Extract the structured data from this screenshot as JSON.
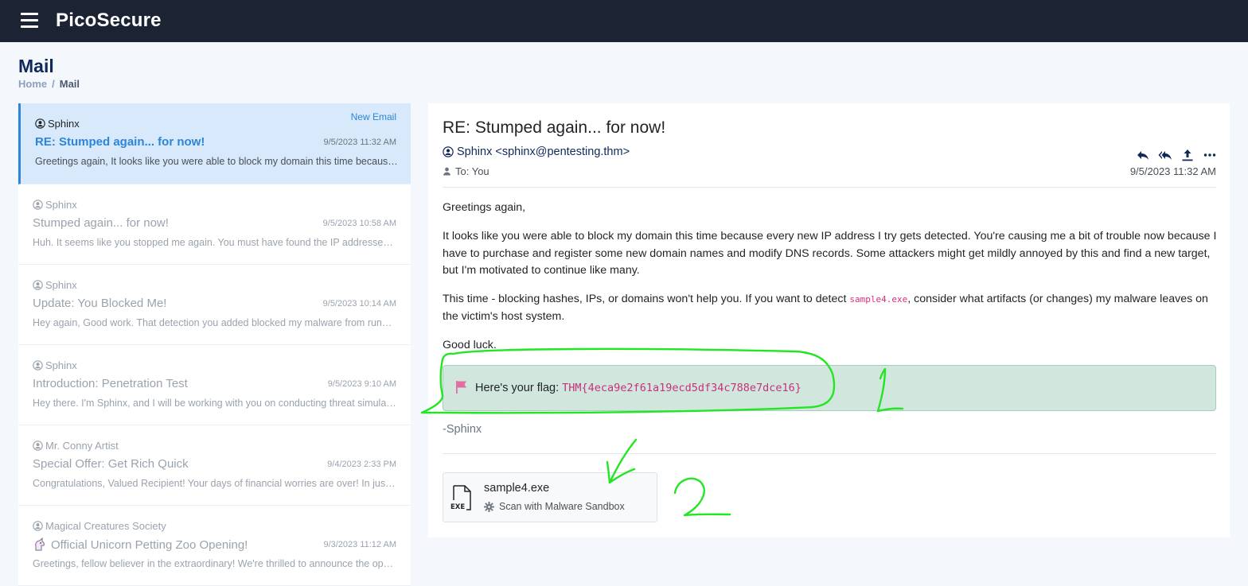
{
  "app": {
    "brand": "PicoSecure"
  },
  "page": {
    "title": "Mail",
    "breadcrumb": {
      "home": "Home",
      "separator": "/",
      "current": "Mail"
    }
  },
  "mail_list": [
    {
      "sender": "Sphinx",
      "subject": "RE: Stumped again... for now!",
      "date": "9/5/2023 11:32 AM",
      "badge": "New Email",
      "preview": "Greetings again, It looks like you were able to block my domain this time because every new IP address I try gets detected.",
      "active": true
    },
    {
      "sender": "Sphinx",
      "subject": "Stumped again... for now!",
      "date": "9/5/2023 10:58 AM",
      "preview": "Huh. It seems like you stopped me again. You must have found the IP addresses I was using."
    },
    {
      "sender": "Sphinx",
      "subject": "Update: You Blocked Me!",
      "date": "9/5/2023 10:14 AM",
      "preview": "Hey again, Good work. That detection you added blocked my malware from running."
    },
    {
      "sender": "Sphinx",
      "subject": "Introduction: Penetration Test",
      "date": "9/5/2023 9:10 AM",
      "preview": "Hey there. I'm Sphinx, and I will be working with you on conducting threat simulations."
    },
    {
      "sender": "Mr. Conny Artist",
      "subject": "Special Offer: Get Rich Quick",
      "date": "9/4/2023 2:33 PM",
      "preview": "Congratulations, Valued Recipient! Your days of financial worries are over! In just a few days."
    },
    {
      "sender": "Magical Creatures Society",
      "subject": "Official Unicorn Petting Zoo Opening!",
      "date": "9/3/2023 11:12 AM",
      "preview": "Greetings, fellow believer in the extraordinary! We're thrilled to announce the opening of our zoo."
    }
  ],
  "detail": {
    "subject": "RE: Stumped again... for now!",
    "from": "Sphinx <sphinx@pentesting.thm>",
    "to": "To: You",
    "date": "9/5/2023 11:32 AM",
    "greeting": "Greetings again,",
    "para1": "It looks like you were able to block my domain this time because every new IP address I try gets detected. You're causing me a bit of trouble now because I have to purchase and register some new domain names and modify DNS records. Some attackers might get mildly annoyed by this and find a new target, but I'm motivated to continue like many.",
    "para2_before": "This time - blocking hashes, IPs, or domains won't help you. If you want to detect ",
    "para2_code": "sample4.exe",
    "para2_after": ", consider what artifacts (or changes) my malware leaves on the victim's host system.",
    "closing": "Good luck.",
    "flag_label": "Here's your flag: ",
    "flag_value": "THM{4eca9e2f61a19ecd5df34c788e7dce16}",
    "signature": "-Sphinx",
    "attachment": {
      "name": "sample4.exe",
      "scan_label": "Scan with Malware Sandbox",
      "icon_label": "EXE"
    }
  },
  "icons": {
    "menu": "hamburger-icon",
    "user": "user-circle-icon",
    "reply": "reply-icon",
    "reply_all": "reply-all-icon",
    "share": "upload-icon",
    "more": "more-horizontal-icon",
    "flag": "flag-icon",
    "scan": "gear-icon"
  },
  "colors": {
    "topbar": "#1c2434",
    "accent": "#2b86d9",
    "flag_bg": "#d1e7dd",
    "annotation": "#22e622"
  }
}
